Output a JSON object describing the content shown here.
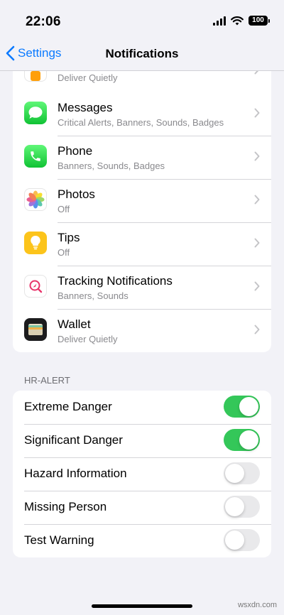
{
  "status_bar": {
    "time": "22:06",
    "battery": "100"
  },
  "nav": {
    "back_label": "Settings",
    "title": "Notifications"
  },
  "apps": [
    {
      "name": "",
      "subtitle": "Deliver Quietly",
      "icon": "books-icon",
      "partial": true
    },
    {
      "name": "Messages",
      "subtitle": "Critical Alerts, Banners, Sounds, Badges",
      "icon": "messages-icon"
    },
    {
      "name": "Phone",
      "subtitle": "Banners, Sounds, Badges",
      "icon": "phone-icon"
    },
    {
      "name": "Photos",
      "subtitle": "Off",
      "icon": "photos-icon"
    },
    {
      "name": "Tips",
      "subtitle": "Off",
      "icon": "tips-icon"
    },
    {
      "name": "Tracking Notifications",
      "subtitle": "Banners, Sounds",
      "icon": "tracking-icon"
    },
    {
      "name": "Wallet",
      "subtitle": "Deliver Quietly",
      "icon": "wallet-icon"
    }
  ],
  "hr_alert": {
    "header": "HR-ALERT",
    "items": [
      {
        "label": "Extreme Danger",
        "on": true
      },
      {
        "label": "Significant Danger",
        "on": true
      },
      {
        "label": "Hazard Information",
        "on": false
      },
      {
        "label": "Missing Person",
        "on": false
      },
      {
        "label": "Test Warning",
        "on": false
      }
    ]
  },
  "watermark": "wsxdn.com",
  "colors": {
    "accent": "#0a7aff",
    "toggle_on": "#34c759",
    "toggle_off": "#e9e9eb",
    "background": "#f2f2f7"
  }
}
